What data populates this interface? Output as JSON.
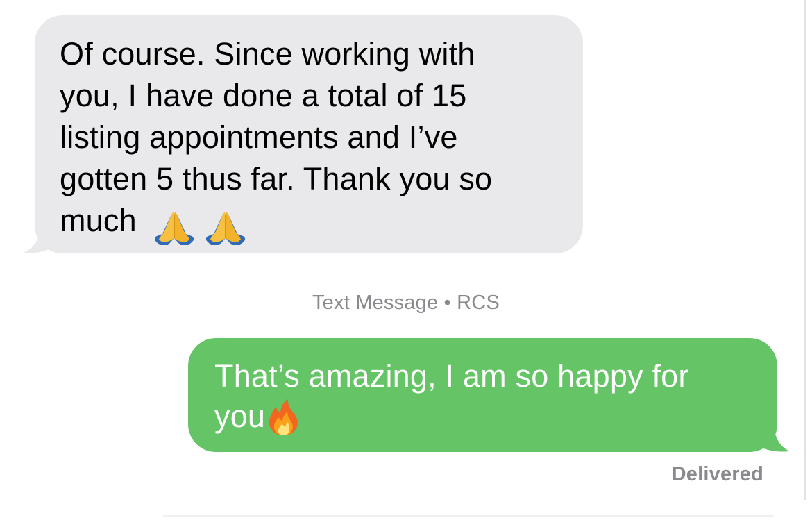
{
  "conversation": {
    "incoming": {
      "text": "Of course. Since working with you, I have done a total of 15 listing appointments and I’ve gotten 5 thus far. Thank you so much",
      "lines": [
        "Of course. Since working with",
        "you, I have done a total of 15",
        "listing appointments and I’ve",
        "gotten 5 thus far. Thank you so",
        "much"
      ],
      "emojis": [
        "folded-hands-icon",
        "folded-hands-icon"
      ],
      "bubble_color": "#e9e9eb",
      "text_color": "#000000"
    },
    "service_label": "Text Message • RCS",
    "outgoing": {
      "lines": [
        "That’s amazing, I am so happy for",
        "you"
      ],
      "emojis": [
        "fire-icon"
      ],
      "bubble_color": "#65c466",
      "text_color": "#ffffff"
    },
    "status": "Delivered"
  },
  "colors": {
    "meta_text": "#8a8a8e",
    "background": "#ffffff"
  }
}
